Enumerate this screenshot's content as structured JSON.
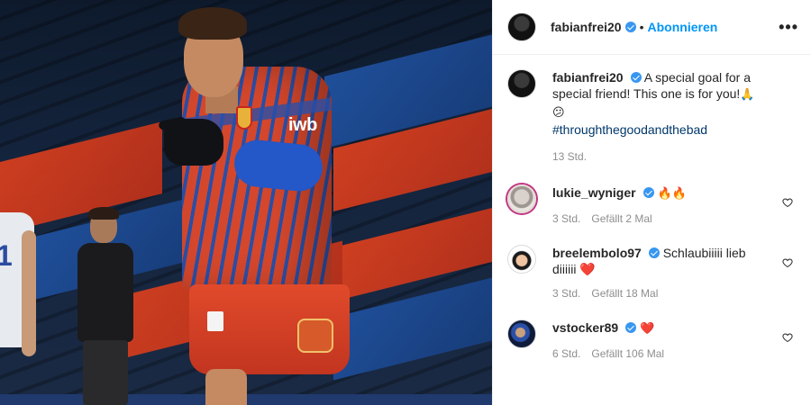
{
  "post": {
    "header": {
      "username": "fabianfrei20",
      "separator": "•",
      "follow_label": "Abonnieren",
      "more_label": "•••"
    },
    "caption": {
      "username": "fabianfrei20",
      "text": "A special goal for a special friend! This one is for you!",
      "emoji_1": "🙏",
      "emoji_2": "😕",
      "hashtag": "#throughthegoodandthebad",
      "time": "13 Std."
    },
    "photo": {
      "sponsor_text": "iwb",
      "left_player_number": "1"
    }
  },
  "comments": [
    {
      "username": "lukie_wyniger",
      "text": "🔥🔥",
      "time": "3 Std.",
      "likes": "Gefällt 2 Mal"
    },
    {
      "username": "breelembolo97",
      "text": "Schlaubiiiii lieb diiiiii ❤️",
      "time": "3 Std.",
      "likes": "Gefällt 18 Mal"
    },
    {
      "username": "vstocker89",
      "text": "❤️",
      "time": "6 Std.",
      "likes": "Gefällt 106 Mal"
    }
  ],
  "colors": {
    "accent": "#0095f6",
    "verified": "#3897f0",
    "heart": "#ed4956",
    "jersey_red": "#d4472c",
    "jersey_blue": "#2a4fa7"
  },
  "icons": {
    "more": "more-horizontal-icon",
    "verified": "verified-badge-icon",
    "like": "heart-outline-icon"
  }
}
